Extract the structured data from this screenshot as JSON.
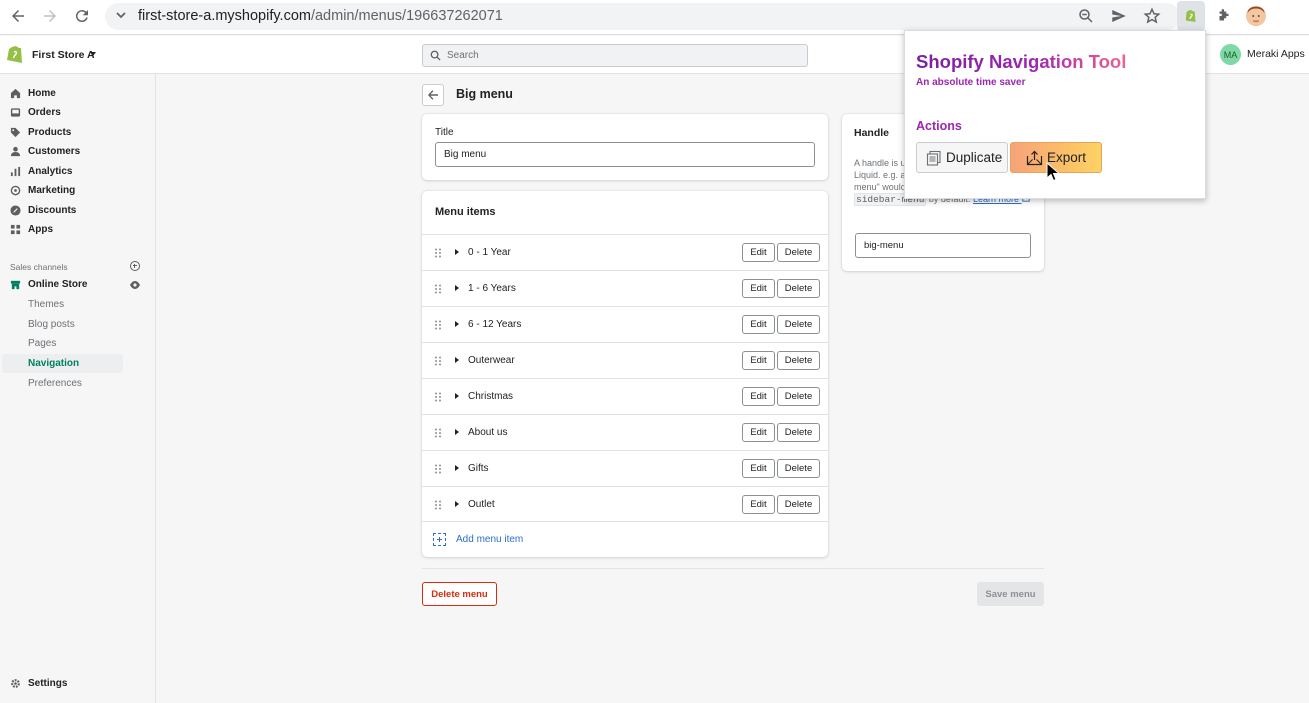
{
  "browser": {
    "url_host": "first-store-a.myshopify.com",
    "url_path": "/admin/menus/196637262071"
  },
  "topbar": {
    "store_name": "First Store A",
    "search_placeholder": "Search",
    "avatar_initials": "MA",
    "account_name": "Meraki Apps"
  },
  "sidebar": {
    "items": [
      {
        "label": "Home",
        "icon": "home-icon"
      },
      {
        "label": "Orders",
        "icon": "orders-icon"
      },
      {
        "label": "Products",
        "icon": "tag-icon"
      },
      {
        "label": "Customers",
        "icon": "person-icon"
      },
      {
        "label": "Analytics",
        "icon": "bar-chart-icon"
      },
      {
        "label": "Marketing",
        "icon": "target-icon"
      },
      {
        "label": "Discounts",
        "icon": "discount-icon"
      },
      {
        "label": "Apps",
        "icon": "apps-icon"
      }
    ],
    "sales_channels_label": "Sales channels",
    "online_store_label": "Online Store",
    "online_store_sub": [
      "Themes",
      "Blog posts",
      "Pages",
      "Navigation",
      "Preferences"
    ],
    "settings_label": "Settings"
  },
  "main": {
    "page_title": "Big menu",
    "title_label": "Title",
    "title_value": "Big menu",
    "menu_items_heading": "Menu items",
    "menu_items": [
      "0 - 1 Year",
      "1 - 6 Years",
      "6 - 12 Years",
      "Outerwear",
      "Christmas",
      "About us",
      "Gifts",
      "Outlet"
    ],
    "edit_label": "Edit",
    "delete_label": "Delete",
    "add_menu_item_label": "Add menu item",
    "handle_heading": "Handle",
    "handle_help_pre": "A handle is u",
    "handle_help_line2": "Liquid. e.g. a",
    "handle_help_line3": "menu\" would",
    "handle_help_code": "sidebar-menu",
    "handle_help_post": " by default. ",
    "learn_more_label": "Learn more",
    "handle_value": "big-menu",
    "delete_menu_label": "Delete menu",
    "save_menu_label": "Save menu"
  },
  "popup": {
    "title": "Shopify Navigation Tool",
    "subtitle": "An absolute time saver",
    "actions_heading": "Actions",
    "duplicate_label": "Duplicate",
    "export_label": "Export"
  },
  "colors": {
    "shopify_green": "#008060",
    "popup_purple": "#9c27b0",
    "link_blue": "#2c6ecb",
    "critical_red": "#d82c0d"
  }
}
